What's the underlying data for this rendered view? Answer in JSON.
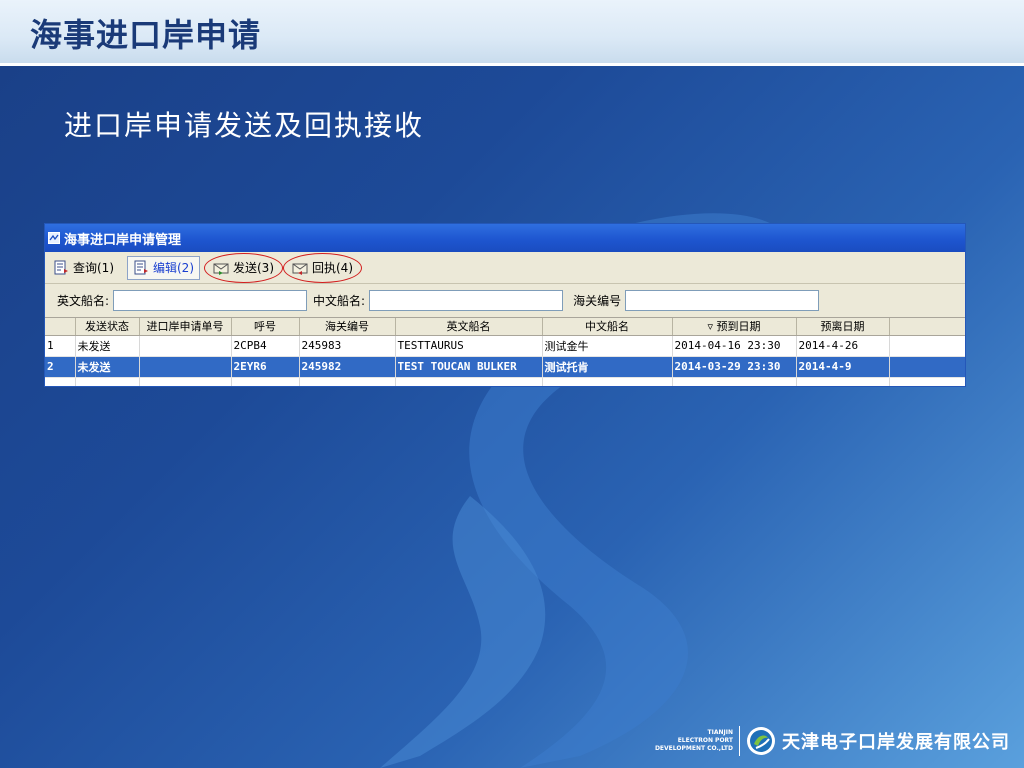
{
  "slide": {
    "title": "海事进口岸申请",
    "subtitle": "进口岸申请发送及回执接收"
  },
  "window": {
    "title": "海事进口岸申请管理",
    "toolbar": [
      {
        "label": "查询(1)",
        "icon": "document-icon",
        "active": false,
        "circled": false
      },
      {
        "label": "编辑(2)",
        "icon": "document-edit-icon",
        "active": true,
        "circled": false
      },
      {
        "label": "发送(3)",
        "icon": "send-icon",
        "active": false,
        "circled": true
      },
      {
        "label": "回执(4)",
        "icon": "receipt-icon",
        "active": false,
        "circled": true
      }
    ],
    "search": {
      "en_ship_label": "英文船名:",
      "en_ship_value": "",
      "cn_ship_label": "中文船名:",
      "cn_ship_value": "",
      "customs_label": "海关编号",
      "customs_value": ""
    },
    "table": {
      "columns": [
        "",
        "发送状态",
        "进口岸申请单号",
        "呼号",
        "海关编号",
        "英文船名",
        "中文船名",
        "▿    预到日期",
        "预离日期",
        ""
      ],
      "rows": [
        [
          "1",
          "未发送",
          "",
          "2CPB4",
          "245983",
          "TESTTAURUS",
          "测试金牛",
          "2014-04-16 23:30",
          "2014-4-26",
          ""
        ],
        [
          "2",
          "未发送",
          "",
          "2EYR6",
          "245982",
          "TEST TOUCAN BULKER",
          "测试托肯",
          "2014-03-29 23:30",
          "2014-4-9",
          ""
        ]
      ],
      "selected_row": 1
    }
  },
  "footer": {
    "logo_en_lines": [
      "TIANJIN",
      "ELECTRON PORT",
      "DEVELOPMENT CO.,LTD"
    ],
    "logo_cn": "天津电子口岸发展有限公司"
  },
  "colors": {
    "titlebar_blue": "#1e56d0",
    "selection_blue": "#316ac5",
    "highlight_red": "#d21f1f",
    "toolbar_bg": "#ece9d8",
    "slide_title": "#1a3a78"
  }
}
